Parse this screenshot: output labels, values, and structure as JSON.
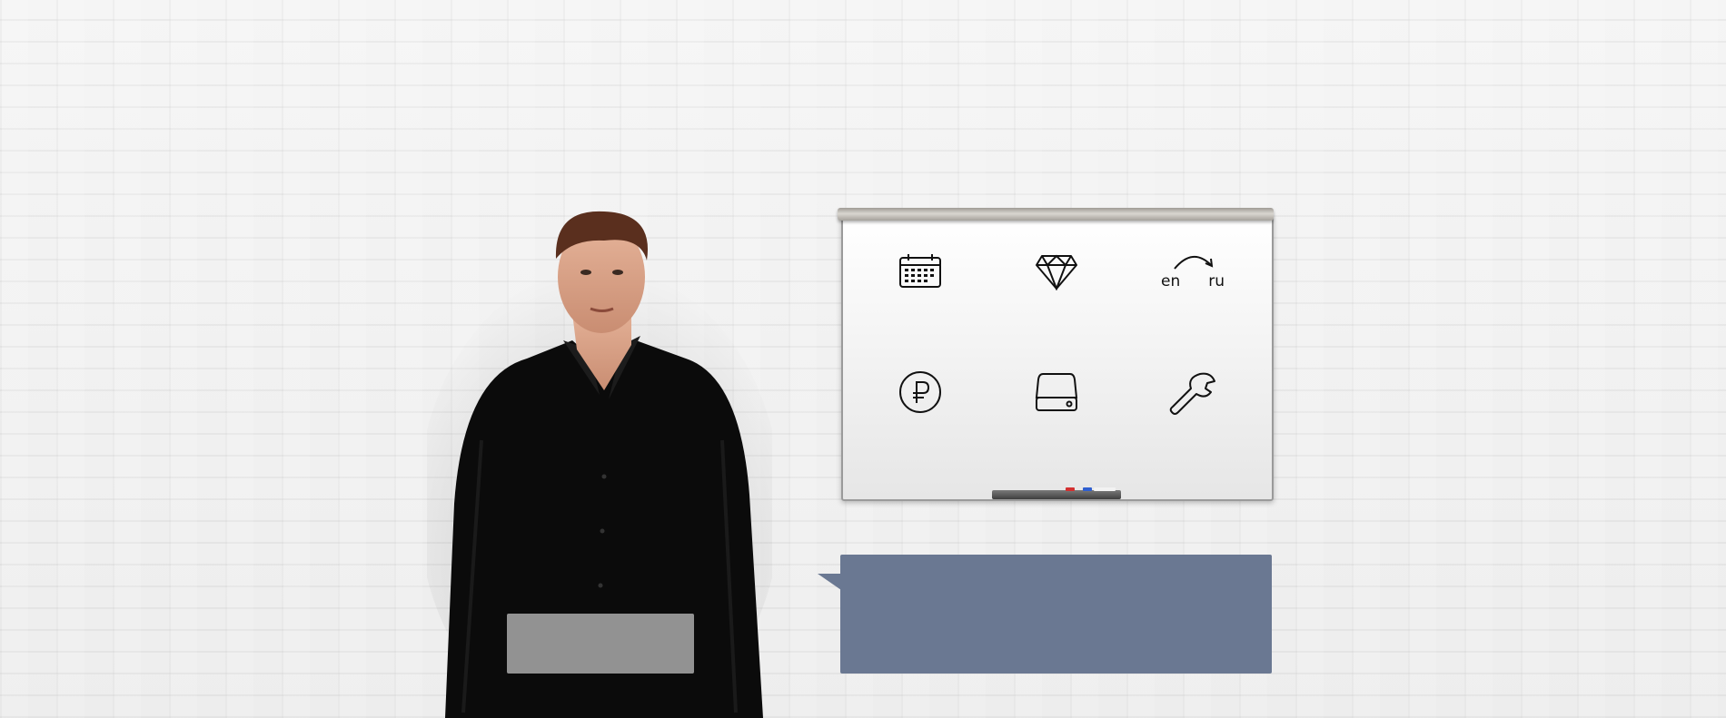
{
  "whiteboard": {
    "icons": [
      {
        "name": "calendar-icon"
      },
      {
        "name": "diamond-icon"
      },
      {
        "name": "language-switch-icon",
        "from": "en",
        "to": "ru"
      },
      {
        "name": "ruble-icon"
      },
      {
        "name": "hard-drive-icon"
      },
      {
        "name": "wrench-icon"
      }
    ]
  },
  "colors": {
    "bubble": "#6a7892",
    "caption": "#aaaaaa",
    "icon_stroke": "#111111"
  }
}
